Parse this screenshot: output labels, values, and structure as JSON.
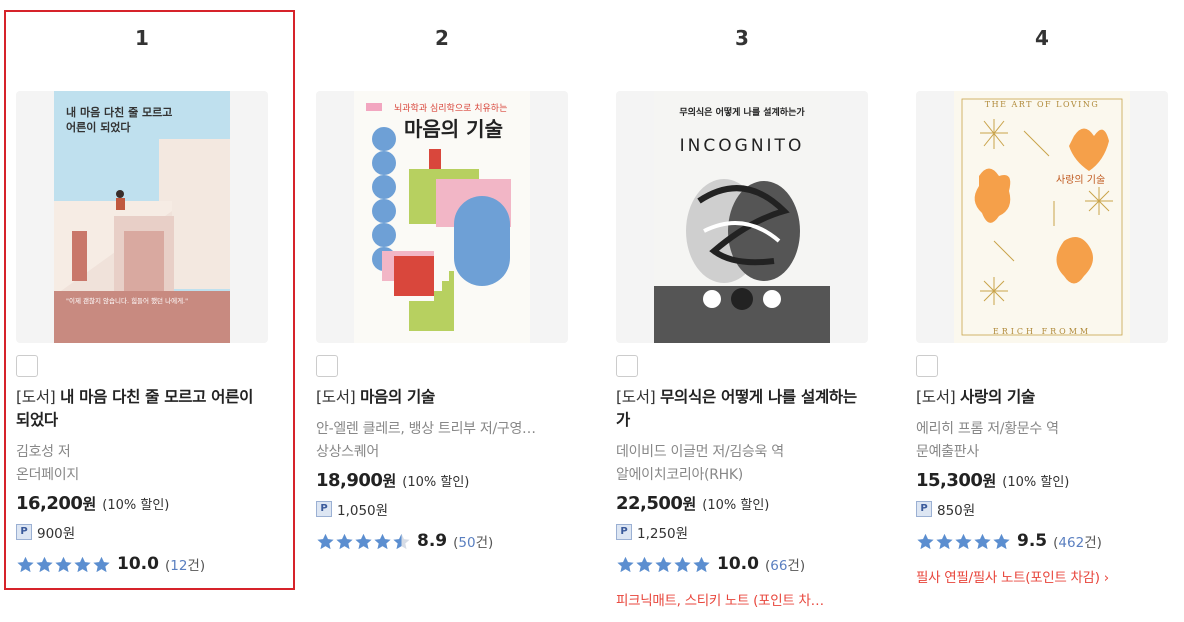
{
  "books": [
    {
      "rank": "1",
      "prefix": "[도서]",
      "title": "내 마음 다친 줄 모르고 어른이 되었다",
      "author": "김호성 저",
      "publisher": "온더페이지",
      "price": "16,200",
      "unit": "원",
      "discount": "(10% 할인)",
      "point": "900원",
      "score": "10.0",
      "reviews": "12",
      "reviews_suffix": "건",
      "stars": 5,
      "cover_title": "내 마음 다친 줄 모르고 어른이 되었다",
      "cover_quote": "\"이제 괜찮지 않습니다. 힘들어 했던 나에게.\""
    },
    {
      "rank": "2",
      "prefix": "[도서]",
      "title": "마음의 기술",
      "author": "안-엘렌 클레르, 뱅상 트리부 저/구영…",
      "publisher": "상상스퀘어",
      "price": "18,900",
      "unit": "원",
      "discount": "(10% 할인)",
      "point": "1,050원",
      "score": "8.9",
      "reviews": "50",
      "reviews_suffix": "건",
      "stars": 4.5,
      "cover_title": "마음의 기술",
      "cover_sub": "뇌과학과 심리학으로 치유하는"
    },
    {
      "rank": "3",
      "prefix": "[도서]",
      "title": "무의식은 어떻게 나를 설계하는가",
      "author": "데이비드 이글먼 저/김승욱 역",
      "publisher": "알에이치코리아(RHK)",
      "price": "22,500",
      "unit": "원",
      "discount": "(10% 할인)",
      "point": "1,250원",
      "score": "10.0",
      "reviews": "66",
      "reviews_suffix": "건",
      "stars": 5,
      "promo": "피크닉매트, 스티키 노트 (포인트 차…",
      "cover_title": "무의식은 어떻게 나를 설계하는가",
      "cover_en": "INCOGNITO"
    },
    {
      "rank": "4",
      "prefix": "[도서]",
      "title": "사랑의 기술",
      "author": "에리히 프롬 저/황문수 역",
      "publisher": "문예출판사",
      "price": "15,300",
      "unit": "원",
      "discount": "(10% 할인)",
      "point": "850원",
      "score": "9.5",
      "reviews": "462",
      "reviews_suffix": "건",
      "stars": 5,
      "promo": "필사 연필/필사 노트(포인트 차감) ›",
      "cover_title": "사랑의 기술",
      "cover_en_top": "THE ART OF LOVING",
      "cover_en_bottom": "ERICH FROMM"
    }
  ],
  "icons": {
    "checkbox": "checkbox-icon",
    "point": "point-badge-icon",
    "star": "star-icon"
  },
  "point_badge": "P",
  "colors": {
    "highlight": "#d6232a",
    "star": "#5b8ed0",
    "promo": "#e8463c",
    "review_count": "#5a7fc0"
  }
}
